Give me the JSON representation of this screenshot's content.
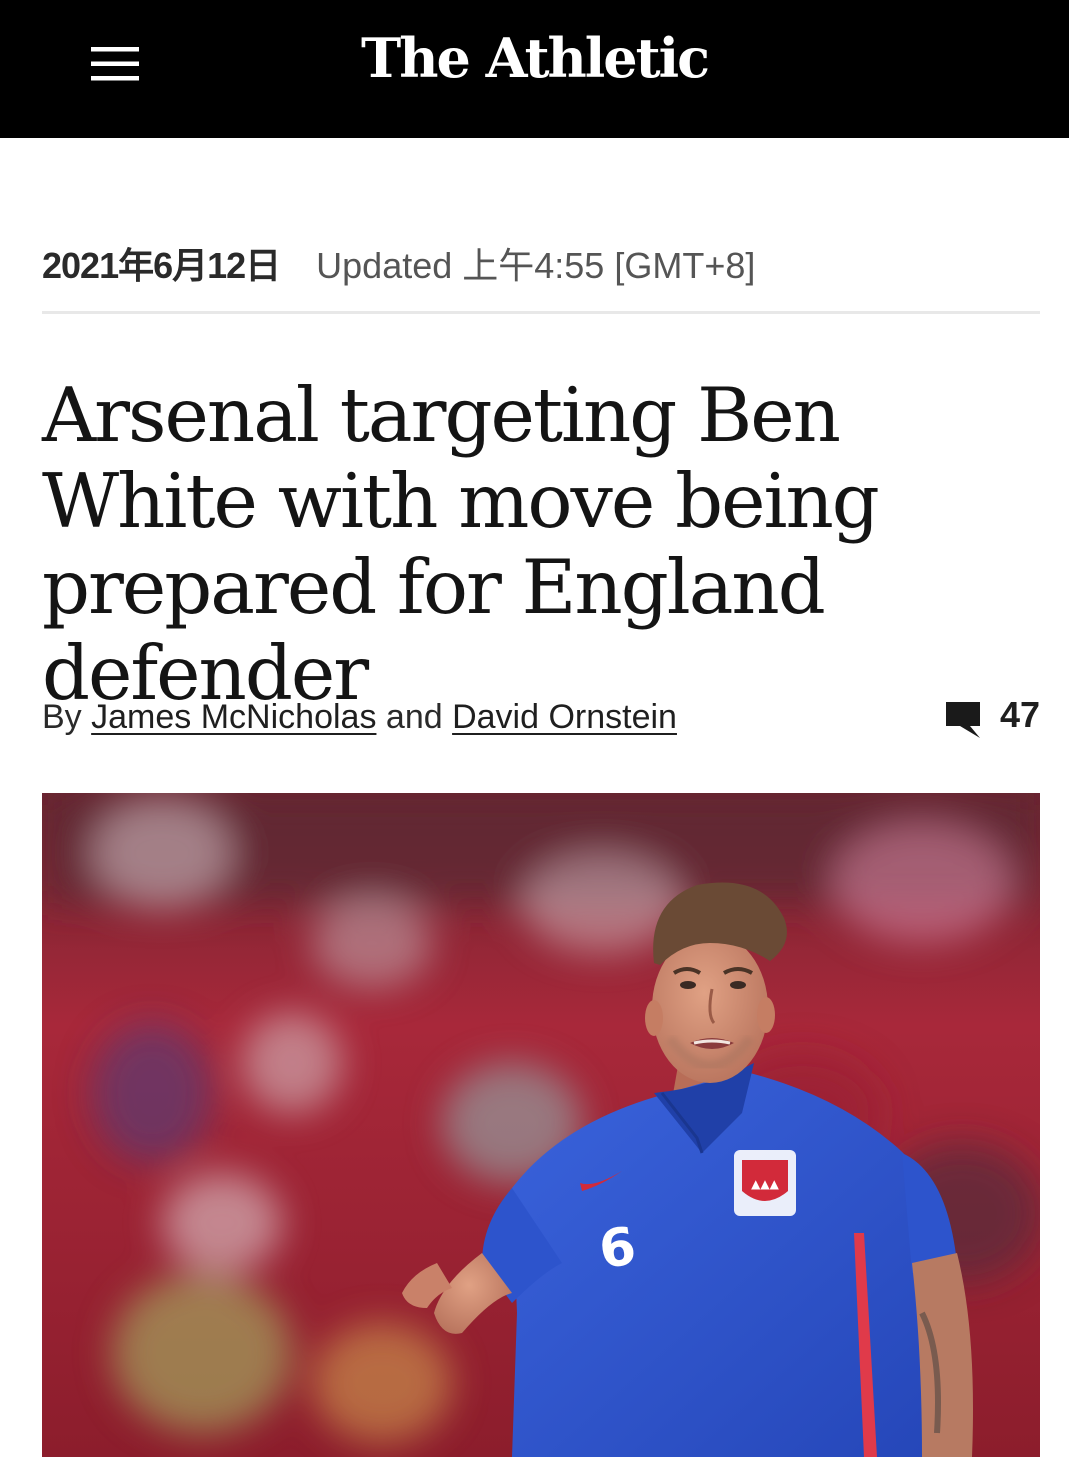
{
  "header": {
    "logo_text": "The Athletic",
    "menu_icon": "hamburger-menu-icon",
    "background": "#000000"
  },
  "article": {
    "date": "2021年6月12日",
    "updated": "Updated 上午4:55 [GMT+8]",
    "headline": "Arsenal targeting Ben White with move being prepared for England defender",
    "byline": {
      "prefix": "By",
      "author1": "James McNicholas",
      "connector": "and",
      "author2": "David Ornstein"
    },
    "comments": {
      "icon": "comment-bubble-icon",
      "count": "47"
    },
    "hero_image": {
      "shirt_number": "6",
      "colors": {
        "shirt": "#2f58d3",
        "stand": "#b5283a",
        "skin": "#c9846a"
      }
    }
  }
}
